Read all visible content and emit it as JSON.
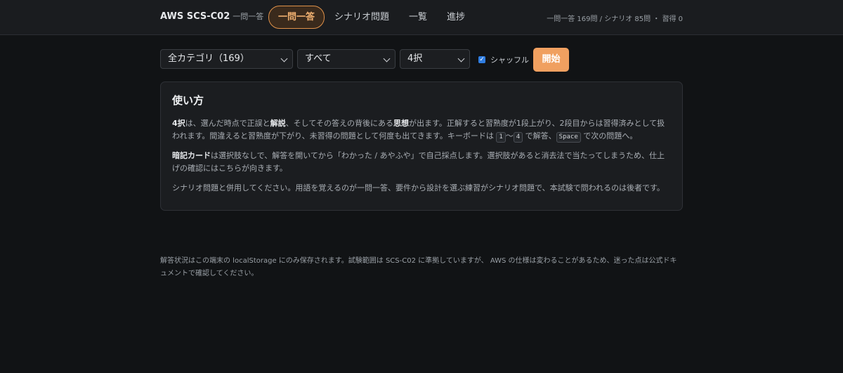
{
  "header": {
    "title": "AWS SCS-C02",
    "subtitle": "一問一答",
    "tabs": [
      {
        "label": "一問一答"
      },
      {
        "label": "シナリオ問題"
      },
      {
        "label": "一覧"
      },
      {
        "label": "進捗"
      }
    ],
    "stats": "一問一答 169問 / シナリオ 85問 ・ 習得 0"
  },
  "controls": {
    "category": "全カテゴリ（169）",
    "filter": "すべて",
    "mode": "4択",
    "shuffle_label": "シャッフル",
    "shuffle_checked": true,
    "start_label": "開始"
  },
  "howto": {
    "title": "使い方",
    "p1": {
      "term1": "4択",
      "t1": "は、選んだ時点で正誤と",
      "term2": "解説",
      "t2": "、そしてその答えの背後にある",
      "term3": "思想",
      "t3": "が出ます。正解すると習熟度が1段上がり、2段目からは習得済みとして扱われます。間違えると習熟度が下がり、未習得の問題として何度も出てきます。キーボードは ",
      "key1": "1",
      "tilde": "〜",
      "key2": "4",
      "t4": " で解答、",
      "key3": "Space",
      "t5": " で次の問題へ。"
    },
    "p2": {
      "term": "暗記カード",
      "text": "は選択肢なしで、解答を開いてから「わかった / あやふや」で自己採点します。選択肢があると消去法で当たってしまうため、仕上げの確認にはこちらが向きます。"
    },
    "p3": "シナリオ問題と併用してください。用語を覚えるのが一問一答、要件から設計を選ぶ練習がシナリオ問題で、本試験で問われるのは後者です。"
  },
  "footer": "解答状況はこの端末の localStorage にのみ保存されます。試験範囲は SCS-C02 に準拠していますが、 AWS の仕様は変わることがあるため、迷った点は公式ドキュメントで確認してください。"
}
